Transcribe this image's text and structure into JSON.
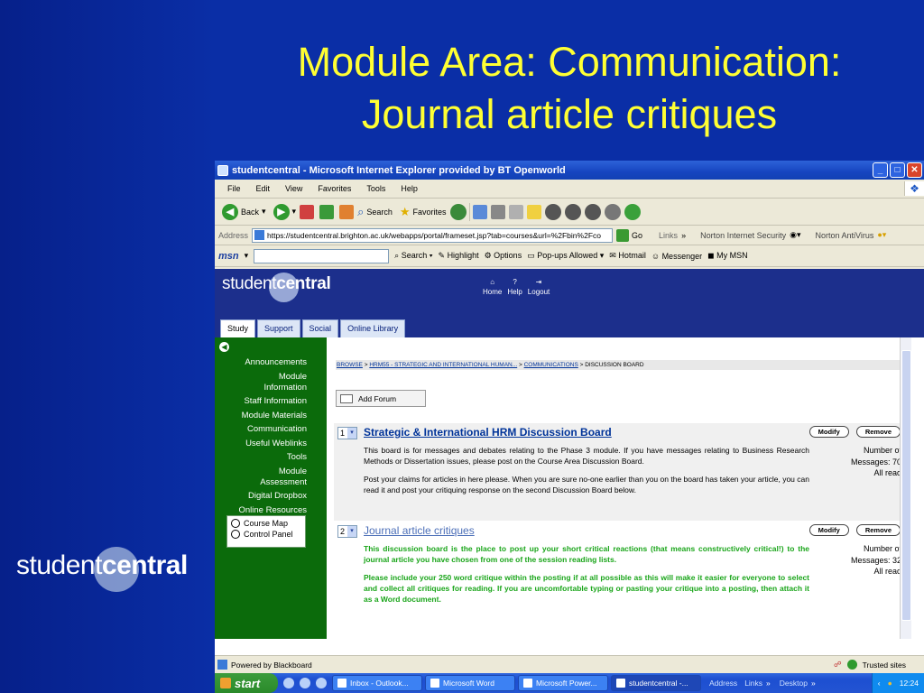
{
  "slide": {
    "title_line1": "Module Area: Communication:",
    "title_line2": "Journal article critiques",
    "logo_light": "student",
    "logo_bold": "central"
  },
  "window": {
    "title": "studentcentral - Microsoft Internet Explorer provided by BT Openworld",
    "menu": [
      "File",
      "Edit",
      "View",
      "Favorites",
      "Tools",
      "Help"
    ],
    "toolbar": {
      "back": "Back",
      "search": "Search",
      "favorites": "Favorites"
    },
    "address_label": "Address",
    "url": "https://studentcentral.brighton.ac.uk/webapps/portal/frameset.jsp?tab=courses&url=%2Fbin%2Fco",
    "go": "Go",
    "links": "Links",
    "norton_security": "Norton Internet Security",
    "norton_antivirus": "Norton AntiVirus",
    "msn": "msn",
    "msn_items": [
      "Search",
      "Highlight",
      "Options",
      "Pop-ups Allowed",
      "Hotmail",
      "Messenger",
      "My MSN"
    ]
  },
  "page": {
    "logo_light": "student",
    "logo_bold": "central",
    "top_nav": [
      "Home",
      "Help",
      "Logout"
    ],
    "tabs": [
      "Study",
      "Support",
      "Social",
      "Online Library"
    ],
    "sidebar": [
      "Announcements",
      "Module Information",
      "Staff Information",
      "Module Materials",
      "Communication",
      "Useful Weblinks",
      "Tools",
      "Module Assessment",
      "Digital Dropbox",
      "Online Resources"
    ],
    "sidebar_box": [
      "Course Map",
      "Control Panel"
    ],
    "breadcrumb": {
      "browse": "BROWSE",
      "module": "HRM55 - STRATEGIC AND INTERNATIONAL HUMAN...",
      "communications": "COMMUNICATIONS",
      "current": "DISCUSSION BOARD"
    },
    "add_forum": "Add Forum",
    "forums": [
      {
        "num": "1",
        "title": "Strategic & International HRM Discussion Board",
        "modify": "Modify",
        "remove": "Remove",
        "desc1": "This board is for messages and debates relating to the Phase 3 module. If you have messages relating to Business Research Methods or Dissertation issues, please post on the Course Area Discussion Board.",
        "desc2": "Post your claims for articles in here please. When you are sure no-one earlier than you on the board has taken your article, you can read it and post your critiquing response on the second Discussion Board below.",
        "meta1": "Number of",
        "meta2": "Messages: 70",
        "meta3": "All read"
      },
      {
        "num": "2",
        "title": "Journal article critiques",
        "modify": "Modify",
        "remove": "Remove",
        "desc1": "This discussion board is the place to post up your short critical reactions (that means constructively critical!) to the journal article you have chosen from one of the session reading lists.",
        "desc2": "Please include your 250 word critique within the posting if at all possible as this will make it easier for everyone to select and collect all critiques for reading. If you are uncomfortable typing or pasting your critique into a posting, then attach it as a Word document.",
        "meta1": "Number of",
        "meta2": "Messages: 32",
        "meta3": "All read"
      }
    ]
  },
  "status": {
    "left": "Powered by Blackboard",
    "zone": "Trusted sites"
  },
  "taskbar": {
    "start": "start",
    "tasks": [
      "Inbox - Outlook...",
      "Microsoft Word",
      "Microsoft Power...",
      "studentcentral -..."
    ],
    "tray_items": [
      "Address",
      "Links",
      "Desktop"
    ],
    "clock": "12:24"
  }
}
